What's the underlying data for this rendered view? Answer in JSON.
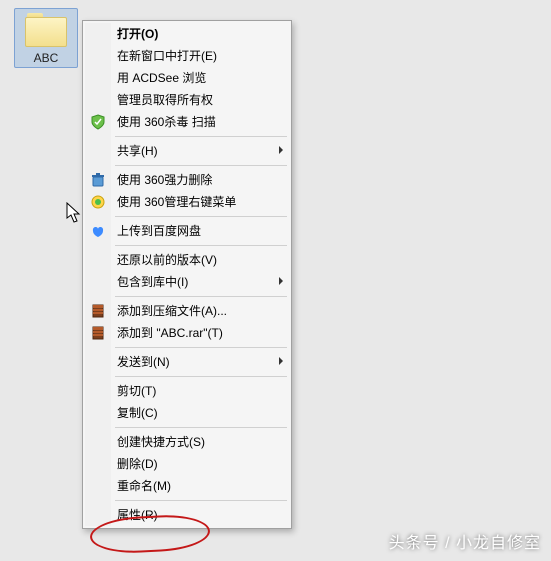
{
  "folder": {
    "name": "ABC"
  },
  "menu": {
    "groups": [
      [
        {
          "label": "打开(O)",
          "bold": true
        },
        {
          "label": "在新窗口中打开(E)"
        },
        {
          "label": "用 ACDSee 浏览"
        },
        {
          "label": "管理员取得所有权"
        },
        {
          "label": "使用 360杀毒 扫描",
          "icon": "shield"
        }
      ],
      [
        {
          "label": "共享(H)",
          "submenu": true
        }
      ],
      [
        {
          "label": "使用 360强力删除",
          "icon": "trash360"
        },
        {
          "label": "使用 360管理右键菜单",
          "icon": "ball360"
        }
      ],
      [
        {
          "label": "上传到百度网盘",
          "icon": "baidupan"
        }
      ],
      [
        {
          "label": "还原以前的版本(V)"
        },
        {
          "label": "包含到库中(I)",
          "submenu": true
        }
      ],
      [
        {
          "label": "添加到压缩文件(A)...",
          "icon": "rar"
        },
        {
          "label": "添加到 \"ABC.rar\"(T)",
          "icon": "rar"
        }
      ],
      [
        {
          "label": "发送到(N)",
          "submenu": true
        }
      ],
      [
        {
          "label": "剪切(T)"
        },
        {
          "label": "复制(C)"
        }
      ],
      [
        {
          "label": "创建快捷方式(S)"
        },
        {
          "label": "删除(D)"
        },
        {
          "label": "重命名(M)"
        }
      ],
      [
        {
          "label": "属性(R)"
        }
      ]
    ]
  },
  "watermark": "头条号 / 小龙自修室"
}
